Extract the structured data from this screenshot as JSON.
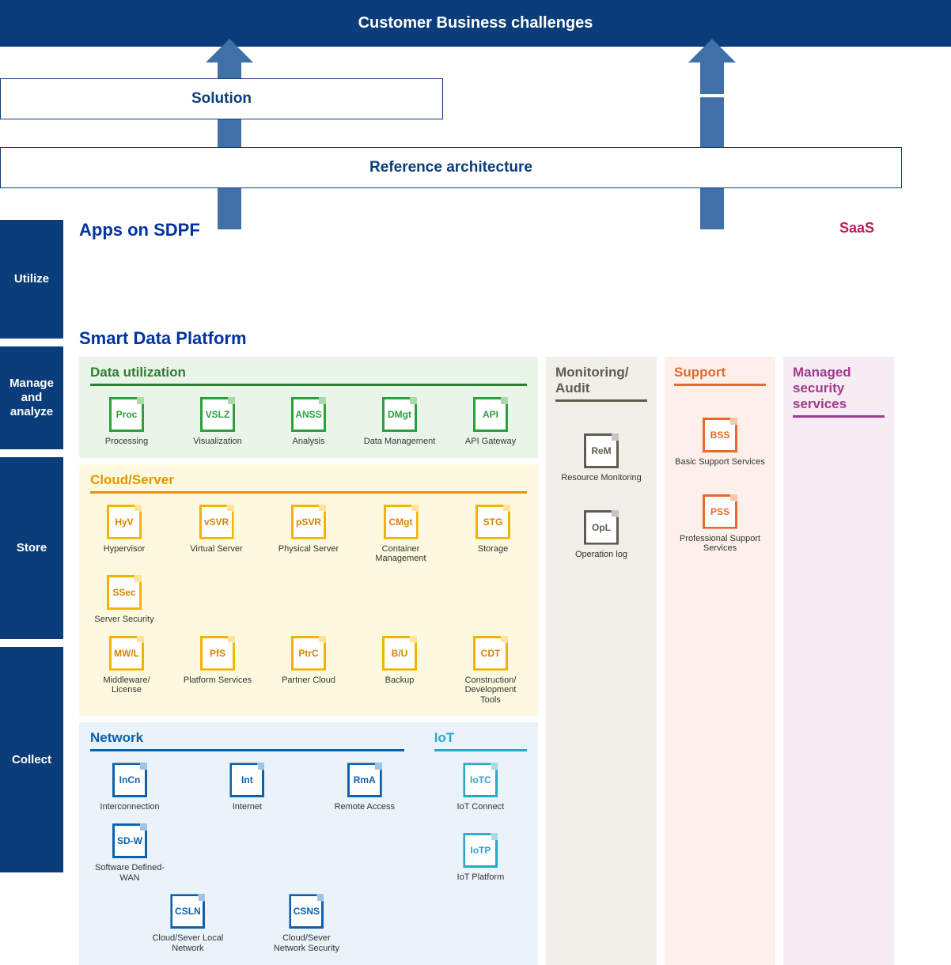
{
  "header": {
    "title": "Customer Business challenges"
  },
  "boxes": {
    "solution": "Solution",
    "reference": "Reference architecture"
  },
  "apps": {
    "title": "Apps on SDPF",
    "saas": "SaaS"
  },
  "sdp": {
    "title": "Smart Data Platform"
  },
  "side": {
    "utilize": "Utilize",
    "manage": "Manage and analyze",
    "store": "Store",
    "collect": "Collect"
  },
  "panels": {
    "data_util": {
      "title": "Data utilization"
    },
    "cloud": {
      "title": "Cloud/Server"
    },
    "network": {
      "title": "Network"
    },
    "iot": {
      "title": "IoT"
    },
    "monitoring": {
      "title": "Monitoring/ Audit"
    },
    "support": {
      "title": "Support"
    },
    "managed": {
      "title": "Managed security services"
    }
  },
  "services": {
    "data_util": [
      {
        "code": "Proc",
        "label": "Processing"
      },
      {
        "code": "VSLZ",
        "label": "Visualization"
      },
      {
        "code": "ANSS",
        "label": "Analysis"
      },
      {
        "code": "DMgt",
        "label": "Data Management"
      },
      {
        "code": "API",
        "label": "API Gateway"
      }
    ],
    "cloud_row1": [
      {
        "code": "HyV",
        "label": "Hypervisor"
      },
      {
        "code": "vSVR",
        "label": "Virtual Server"
      },
      {
        "code": "pSVR",
        "label": "Physical Server"
      },
      {
        "code": "CMgt",
        "label": "Container Management"
      },
      {
        "code": "STG",
        "label": "Storage"
      },
      {
        "code": "SSec",
        "label": "Server Security"
      }
    ],
    "cloud_row2": [
      {
        "code": "MW/L",
        "label": "Middleware/ License"
      },
      {
        "code": "PfS",
        "label": "Platform Services"
      },
      {
        "code": "PtrC",
        "label": "Partner Cloud"
      },
      {
        "code": "B/U",
        "label": "Backup"
      },
      {
        "code": "CDT",
        "label": "Construction/ Development Tools"
      }
    ],
    "network_row1": [
      {
        "code": "InCn",
        "label": "Interconnection"
      },
      {
        "code": "Int",
        "label": "Internet"
      },
      {
        "code": "RmA",
        "label": "Remote Access"
      },
      {
        "code": "SD-W",
        "label": "Software Defined-WAN"
      }
    ],
    "network_row2": [
      {
        "code": "CSLN",
        "label": "Cloud/Sever Local Network"
      },
      {
        "code": "CSNS",
        "label": "Cloud/Sever Network Security"
      }
    ],
    "iot": [
      {
        "code": "IoTC",
        "label": "IoT Connect"
      },
      {
        "code": "IoTP",
        "label": "IoT Platform"
      }
    ],
    "monitoring": [
      {
        "code": "ReM",
        "label": "Resource Monitoring"
      },
      {
        "code": "OpL",
        "label": "Operation log"
      }
    ],
    "support": [
      {
        "code": "BSS",
        "label": "Basic Support Services"
      },
      {
        "code": "PSS",
        "label": "Professional Support Services"
      }
    ]
  }
}
